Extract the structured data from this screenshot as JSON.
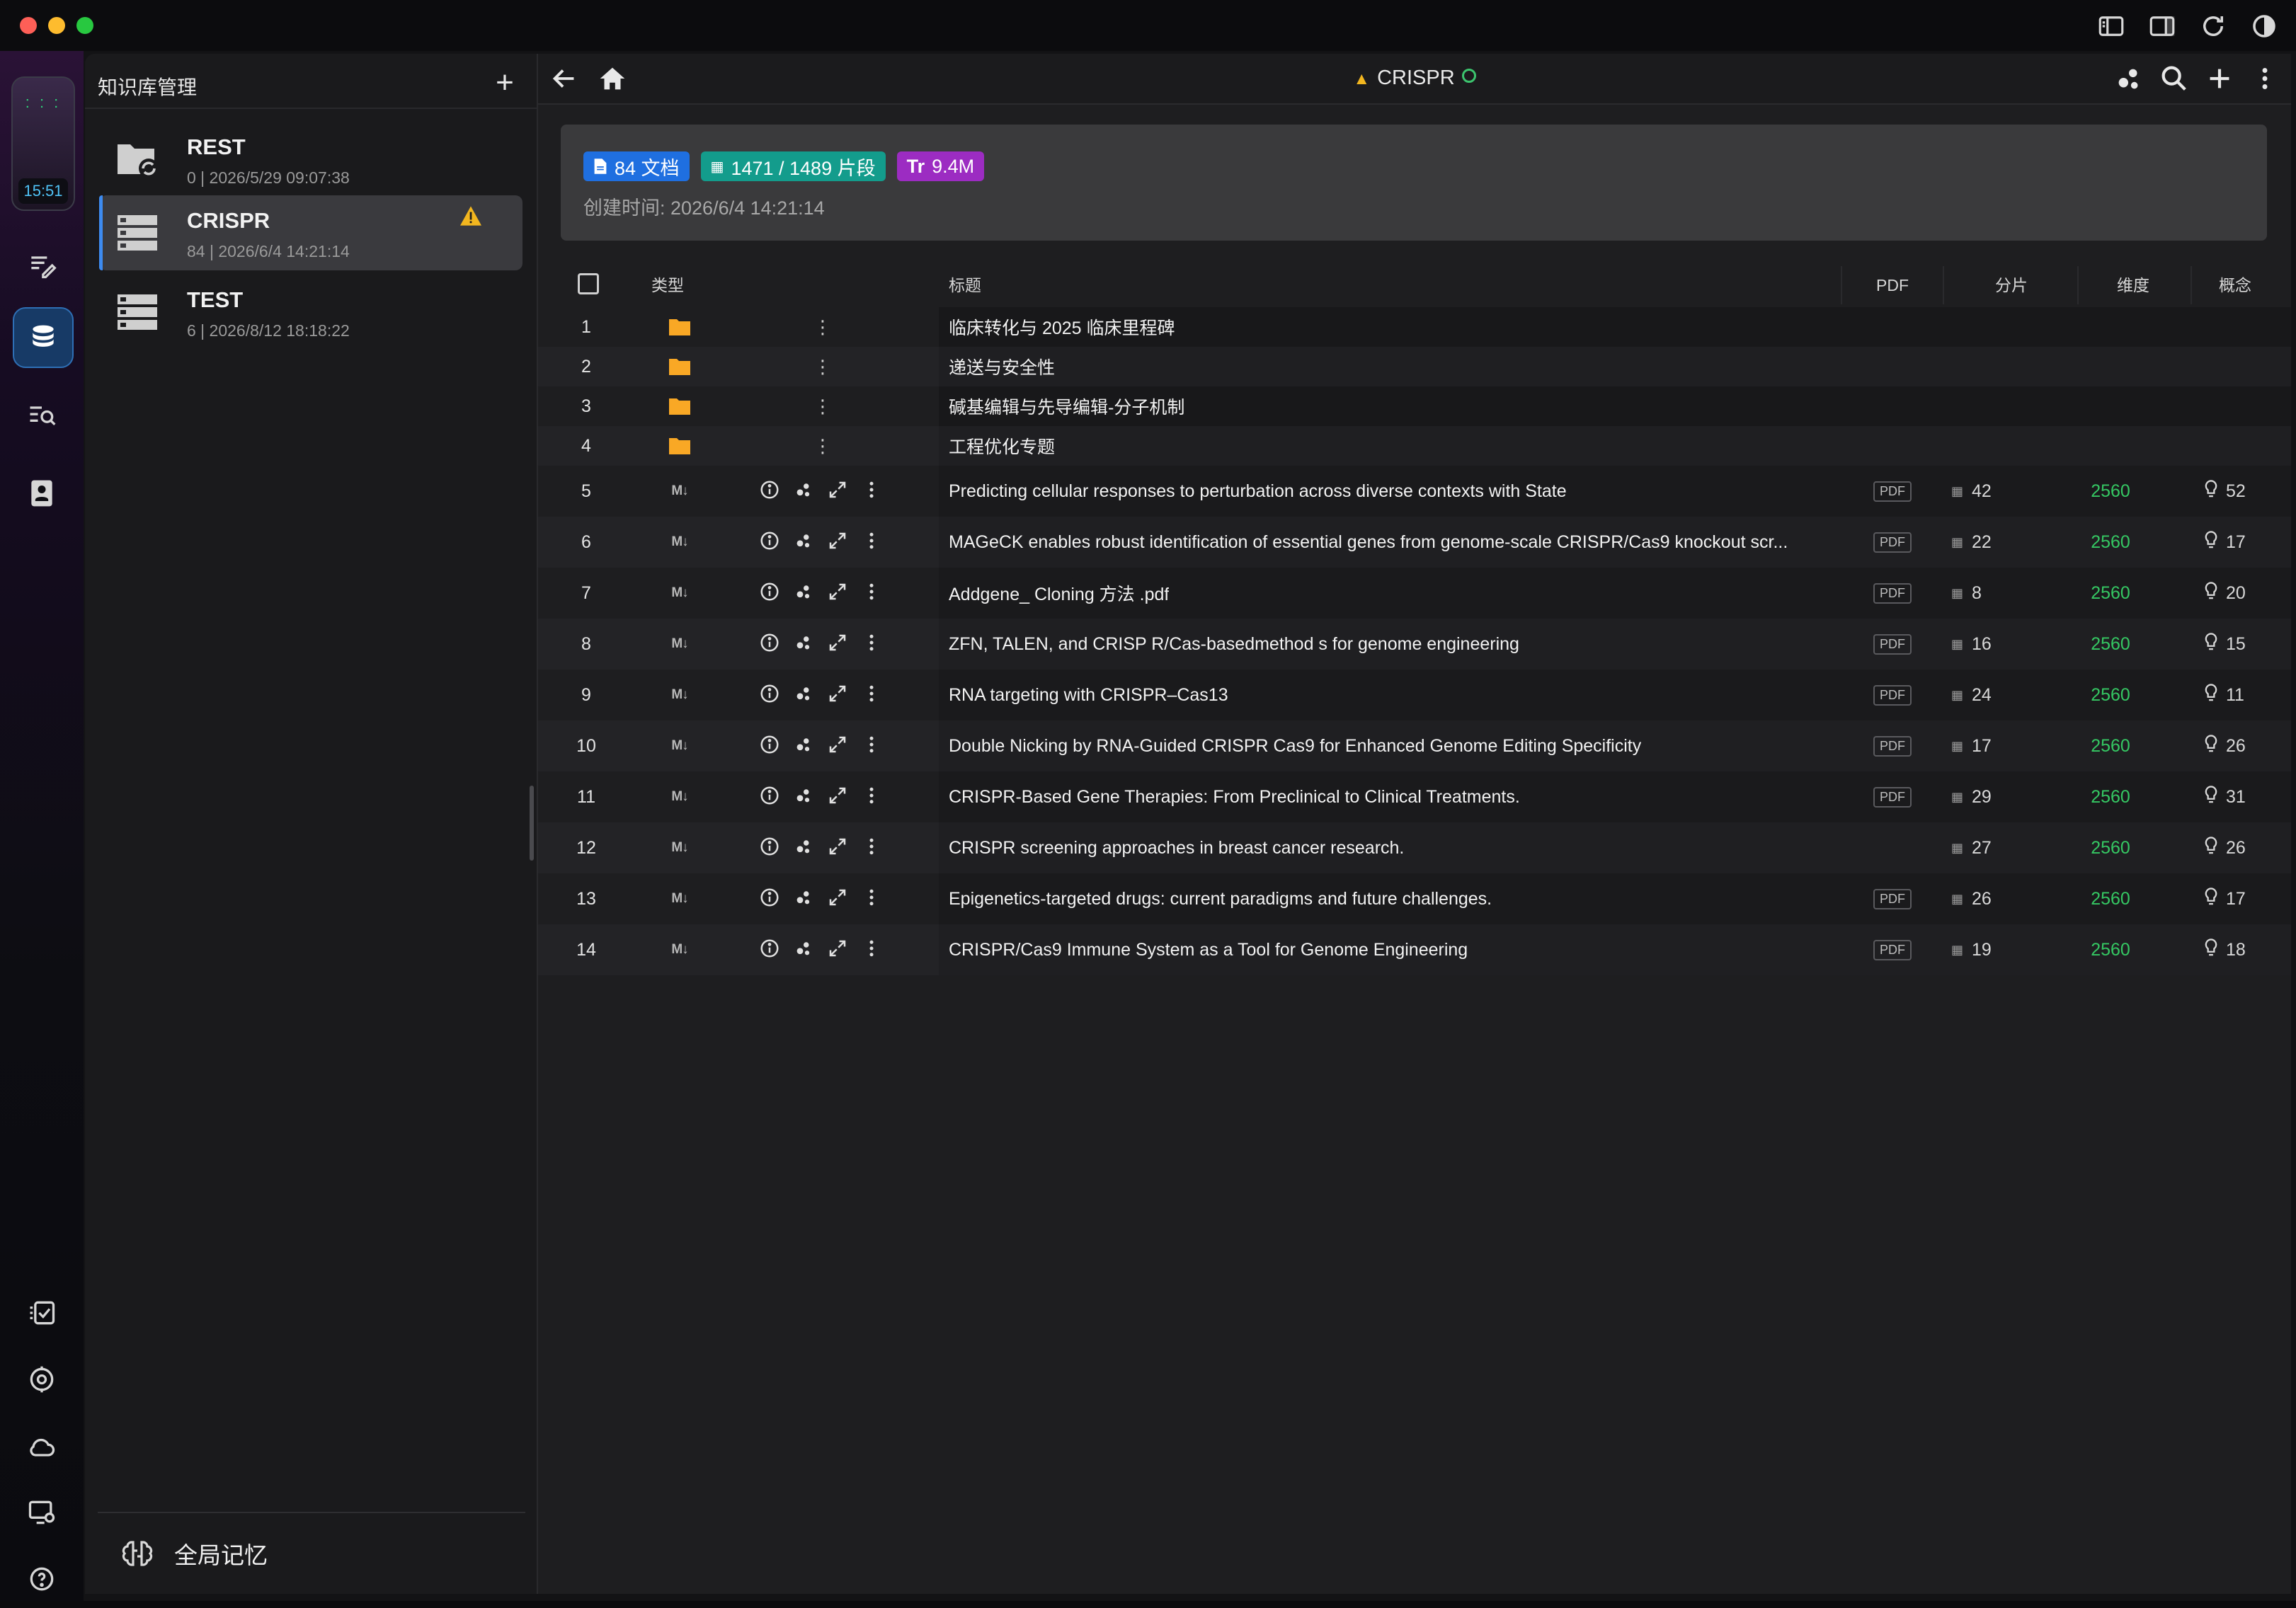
{
  "titlebar": {
    "icons": [
      "sidebar-left-icon",
      "sidebar-right-icon",
      "refresh-icon",
      "theme-contrast-icon"
    ]
  },
  "rail": {
    "clock": {
      "time": "15:51"
    },
    "buttons": [
      "notes-edit-icon",
      "database-icon",
      "search-list-icon",
      "contact-book-icon",
      "checklist-icon",
      "ai-settings-icon",
      "cloud-icon",
      "screen-settings-icon",
      "help-icon"
    ]
  },
  "sidebar": {
    "title": "知识库管理",
    "add_label": "+",
    "items": [
      {
        "name": "REST",
        "meta": "0 | 2026/5/29 09:07:38",
        "icon": "folder-sync-icon",
        "warning": false
      },
      {
        "name": "CRISPR",
        "meta": "84 | 2026/6/4 14:21:14",
        "icon": "database-stack-icon",
        "warning": true
      },
      {
        "name": "TEST",
        "meta": "6 | 2026/8/12 18:18:22",
        "icon": "database-stack-icon",
        "warning": false
      }
    ],
    "footer_label": "全局记忆"
  },
  "main": {
    "breadcrumb": "CRISPR",
    "info": {
      "docs": "84 文档",
      "segments": "1471 / 1489 片段",
      "size": "9.4M",
      "created": "创建时间: 2026/6/4 14:21:14"
    },
    "columns": {
      "type": "类型",
      "title": "标题",
      "pdf": "PDF",
      "segments": "分片",
      "dimension": "维度",
      "concept": "概念"
    },
    "folders": [
      {
        "num": "1",
        "title": "临床转化与 2025 临床里程碑"
      },
      {
        "num": "2",
        "title": "递送与安全性"
      },
      {
        "num": "3",
        "title": "碱基编辑与先导编辑-分子机制"
      },
      {
        "num": "4",
        "title": "工程优化专题"
      }
    ],
    "docs": [
      {
        "num": "5",
        "title": "Predicting cellular responses to perturbation across diverse contexts with State",
        "pdf": "PDF",
        "segments": "42",
        "dim": "2560",
        "concept": "52"
      },
      {
        "num": "6",
        "title": "MAGeCK enables robust identification of essential genes from genome-scale CRISPR/Cas9 knockout scr...",
        "pdf": "PDF",
        "segments": "22",
        "dim": "2560",
        "concept": "17"
      },
      {
        "num": "7",
        "title": "Addgene_ Cloning 方法 .pdf",
        "pdf": "PDF",
        "segments": "8",
        "dim": "2560",
        "concept": "20"
      },
      {
        "num": "8",
        "title": "ZFN, TALEN, and CRISP R/Cas-basedmethod s for genome engineering",
        "pdf": "PDF",
        "segments": "16",
        "dim": "2560",
        "concept": "15"
      },
      {
        "num": "9",
        "title": "RNA targeting with CRISPR–Cas13",
        "pdf": "PDF",
        "segments": "24",
        "dim": "2560",
        "concept": "11"
      },
      {
        "num": "10",
        "title": "Double Nicking by RNA-Guided CRISPR Cas9 for Enhanced Genome Editing Specificity",
        "pdf": "PDF",
        "segments": "17",
        "dim": "2560",
        "concept": "26"
      },
      {
        "num": "11",
        "title": "CRISPR-Based Gene Therapies: From Preclinical to Clinical Treatments.",
        "pdf": "PDF",
        "segments": "29",
        "dim": "2560",
        "concept": "31"
      },
      {
        "num": "12",
        "title": "CRISPR screening approaches in breast cancer research.",
        "pdf": "",
        "segments": "27",
        "dim": "2560",
        "concept": "26"
      },
      {
        "num": "13",
        "title": "Epigenetics-targeted drugs: current paradigms and future challenges.",
        "pdf": "PDF",
        "segments": "26",
        "dim": "2560",
        "concept": "17"
      },
      {
        "num": "14",
        "title": "CRISPR/Cas9 Immune System as a Tool for Genome Engineering",
        "pdf": "PDF",
        "segments": "19",
        "dim": "2560",
        "concept": "18"
      }
    ],
    "md_glyph": "M↓",
    "more_glyph": "⋮"
  },
  "colors": {
    "accent": "#3d8bf0",
    "warning": "#f2b61f",
    "dimension": "#35c863",
    "folder": "#f9a825"
  }
}
